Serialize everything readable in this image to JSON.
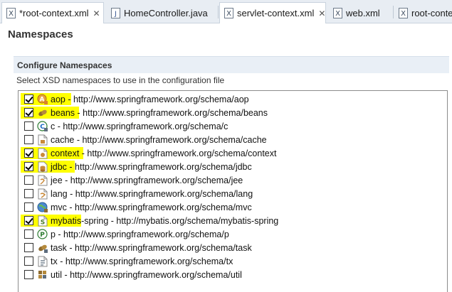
{
  "tabs": [
    {
      "label": "*root-context.xml",
      "icon": "xml-file-icon",
      "active": true,
      "closable": true
    },
    {
      "label": "HomeController.java",
      "icon": "java-file-icon",
      "active": false,
      "closable": false
    },
    {
      "label": "servlet-context.xml",
      "icon": "xml-file-icon",
      "active": true,
      "closable": true
    },
    {
      "label": "web.xml",
      "icon": "xml-file-icon",
      "active": false,
      "closable": false
    },
    {
      "label": "root-contex",
      "icon": "xml-file-icon",
      "active": false,
      "closable": false
    }
  ],
  "close_glyph": "✕",
  "page_title": "Namespaces",
  "section": {
    "title": "Configure Namespaces",
    "description": "Select XSD namespaces to use in the configuration file"
  },
  "namespaces": [
    {
      "label": "aop - http://www.springframework.org/schema/aop",
      "checked": true,
      "highlighted": true,
      "icon": "aop-icon"
    },
    {
      "label": "beans - http://www.springframework.org/schema/beans",
      "checked": true,
      "highlighted": true,
      "icon": "beans-icon"
    },
    {
      "label": "c - http://www.springframework.org/schema/c",
      "checked": false,
      "highlighted": false,
      "icon": "c-namespace-icon"
    },
    {
      "label": "cache - http://www.springframework.org/schema/cache",
      "checked": false,
      "highlighted": false,
      "icon": "cache-icon"
    },
    {
      "label": "context - http://www.springframework.org/schema/context",
      "checked": true,
      "highlighted": true,
      "icon": "context-icon"
    },
    {
      "label": "jdbc - http://www.springframework.org/schema/jdbc",
      "checked": true,
      "highlighted": true,
      "icon": "jdbc-icon"
    },
    {
      "label": "jee - http://www.springframework.org/schema/jee",
      "checked": false,
      "highlighted": false,
      "icon": "jee-icon"
    },
    {
      "label": "lang - http://www.springframework.org/schema/lang",
      "checked": false,
      "highlighted": false,
      "icon": "lang-icon"
    },
    {
      "label": "mvc - http://www.springframework.org/schema/mvc",
      "checked": false,
      "highlighted": false,
      "icon": "mvc-globe-icon"
    },
    {
      "label": "mybatis-spring - http://mybatis.org/schema/mybatis-spring",
      "checked": true,
      "highlighted": true,
      "icon": "mybatis-spring-icon"
    },
    {
      "label": "p - http://www.springframework.org/schema/p",
      "checked": false,
      "highlighted": false,
      "icon": "p-namespace-icon"
    },
    {
      "label": "task - http://www.springframework.org/schema/task",
      "checked": false,
      "highlighted": false,
      "icon": "task-icon"
    },
    {
      "label": "tx - http://www.springframework.org/schema/tx",
      "checked": false,
      "highlighted": false,
      "icon": "tx-icon"
    },
    {
      "label": "util - http://www.springframework.org/schema/util",
      "checked": false,
      "highlighted": false,
      "icon": "util-icon"
    }
  ],
  "colors": {
    "highlight": "#ffff00",
    "tab_bar_bg": "#e8edf3",
    "section_header_bg": "#e9eff6",
    "list_border": "#8c8c8c"
  }
}
